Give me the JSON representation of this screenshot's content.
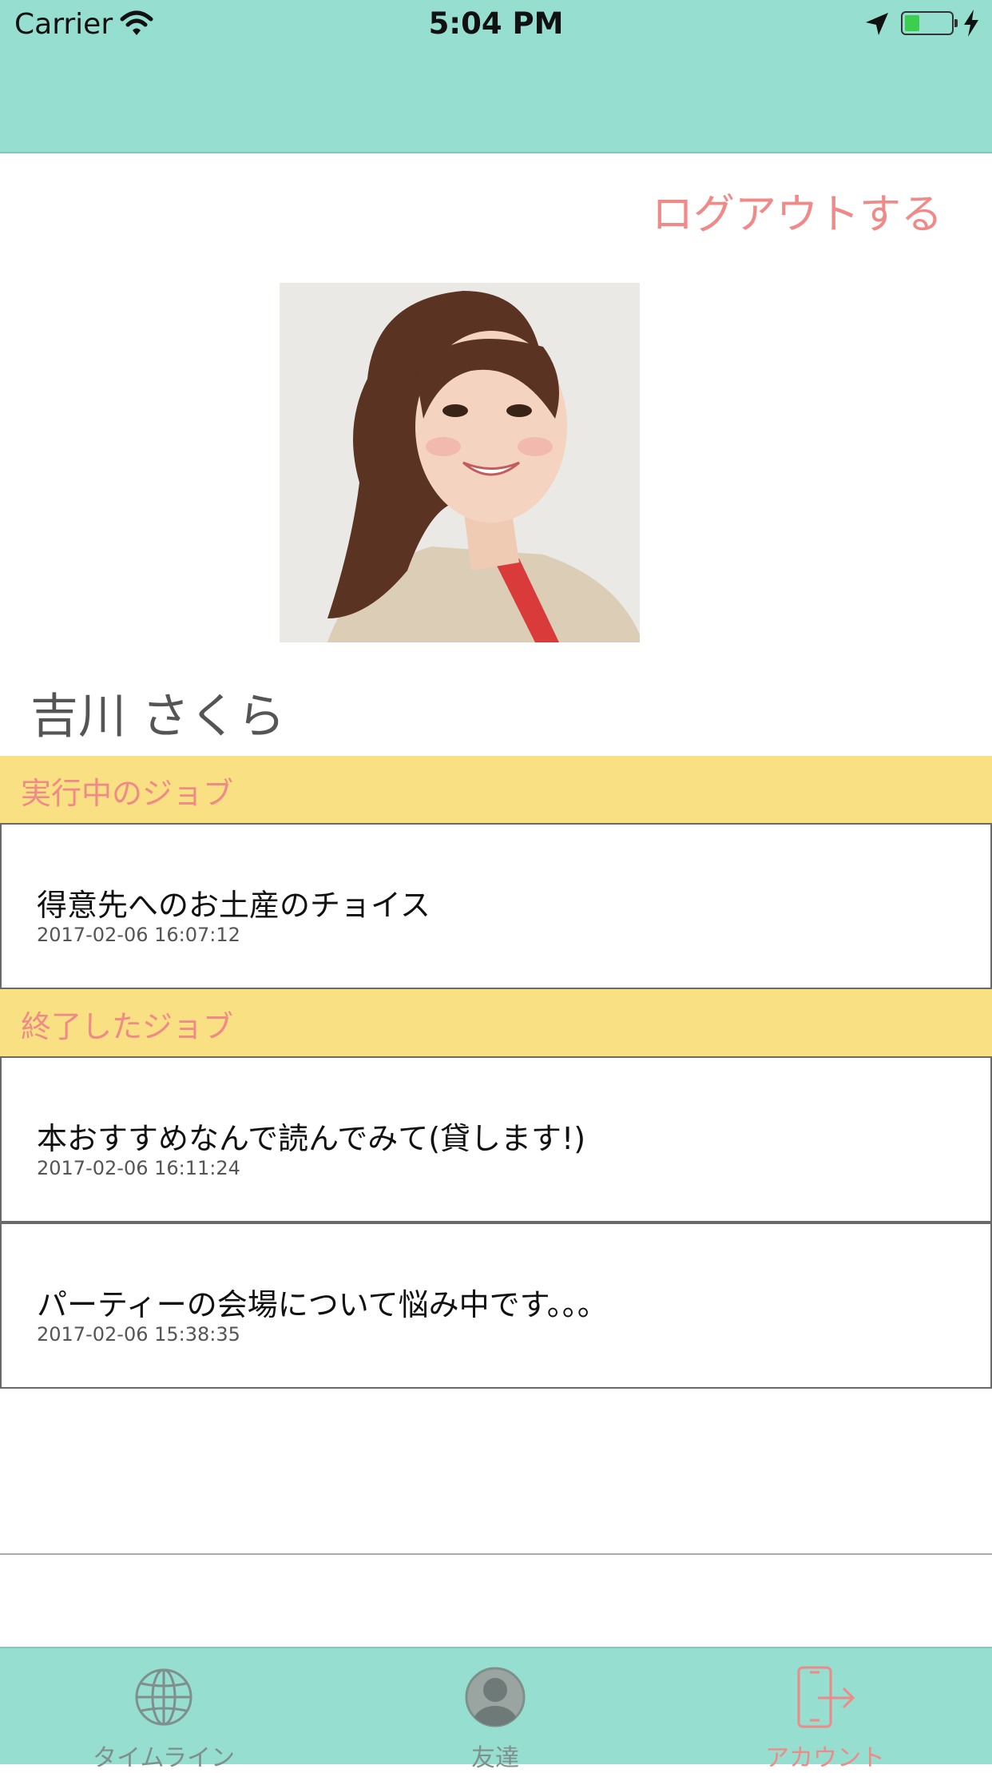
{
  "status_bar": {
    "carrier": "Carrier",
    "time": "5:04 PM",
    "battery_level": 0.33
  },
  "account": {
    "logout_label": "ログアウトする",
    "user_name": "吉川 さくら",
    "avatar_icon": "profile-photo"
  },
  "active_jobs": {
    "header": "実行中のジョブ",
    "items": [
      {
        "title": "得意先へのお土産のチョイス",
        "date": "2017-02-06 16:07:12"
      }
    ]
  },
  "finished_jobs": {
    "header": "終了したジョブ",
    "items": [
      {
        "title": "本おすすめなんで読んでみて(貸します!)",
        "date": "2017-02-06 16:11:24"
      },
      {
        "title": "パーティーの会場について悩み中です。。。",
        "date": "2017-02-06 15:38:35"
      }
    ]
  },
  "tabbar": {
    "tabs": [
      {
        "label": "タイムライン",
        "icon": "globe-icon",
        "active": false
      },
      {
        "label": "友達",
        "icon": "person-icon",
        "active": false
      },
      {
        "label": "アカウント",
        "icon": "logout-phone-icon",
        "active": true
      }
    ]
  },
  "colors": {
    "header_bg": "#95ded0",
    "accent": "#ef8a88",
    "section_bg": "#f9e083"
  }
}
